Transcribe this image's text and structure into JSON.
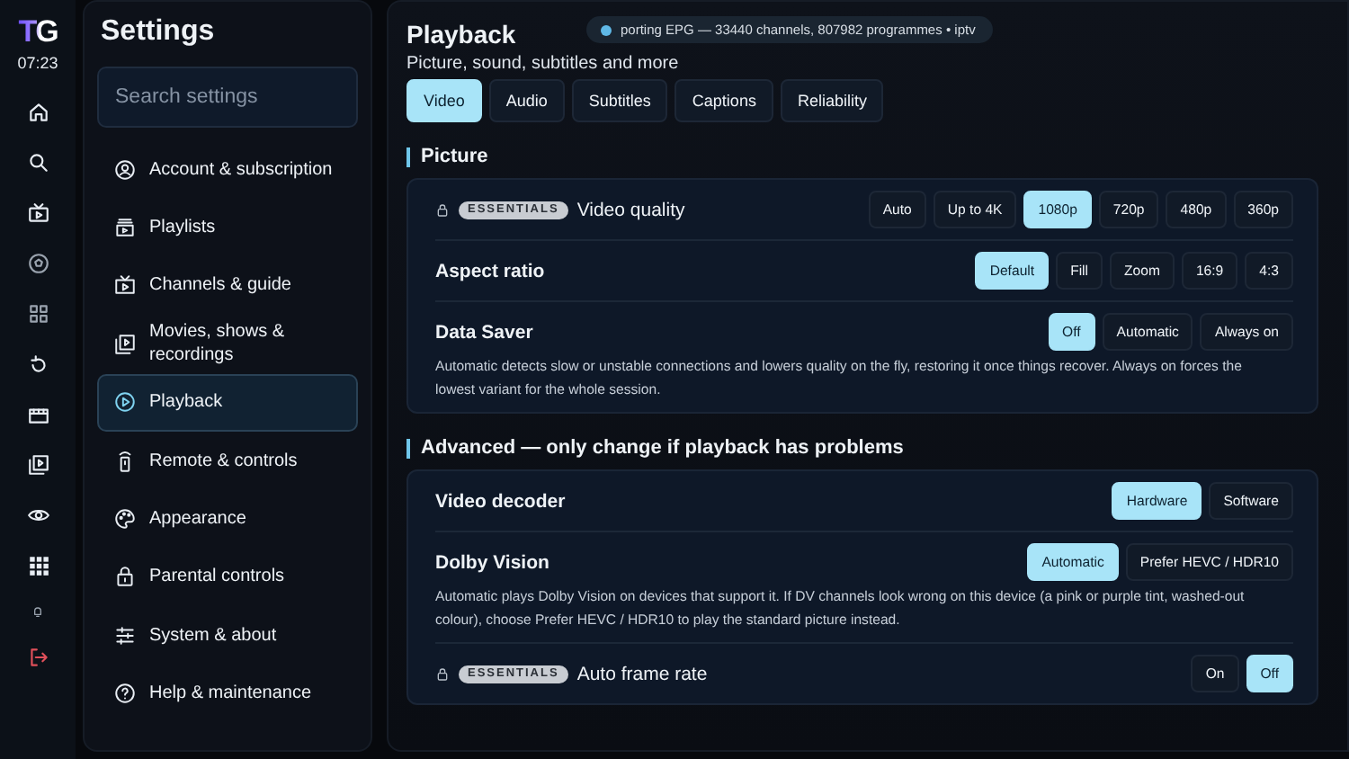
{
  "rail": {
    "logo": "TG",
    "clock": "07:23"
  },
  "sidebar": {
    "title": "Settings",
    "search": {
      "placeholder": "Search settings"
    },
    "items": [
      {
        "label": "Account & subscription",
        "selected": false
      },
      {
        "label": "Playlists",
        "selected": false
      },
      {
        "label": "Channels & guide",
        "selected": false
      },
      {
        "label": "Movies, shows & recordings",
        "selected": false
      },
      {
        "label": "Playback",
        "selected": true
      },
      {
        "label": "Remote & controls",
        "selected": false
      },
      {
        "label": "Appearance",
        "selected": false
      },
      {
        "label": "Parental controls",
        "selected": false
      },
      {
        "label": "System & about",
        "selected": false
      },
      {
        "label": "Help & maintenance",
        "selected": false
      }
    ]
  },
  "main": {
    "title": "Playback",
    "subtitle": "Picture, sound, subtitles and more",
    "toast": "porting EPG — 33440 channels, 807982 programmes • iptv",
    "tabs": [
      {
        "label": "Video",
        "selected": true
      },
      {
        "label": "Audio",
        "selected": false
      },
      {
        "label": "Subtitles",
        "selected": false
      },
      {
        "label": "Captions",
        "selected": false
      },
      {
        "label": "Reliability",
        "selected": false
      }
    ],
    "sections": [
      {
        "title": "Picture",
        "rows": [
          {
            "label": "Video quality",
            "badge": "ESSENTIALS",
            "locked": true,
            "options": [
              {
                "label": "Auto",
                "selected": false
              },
              {
                "label": "Up to 4K",
                "selected": false
              },
              {
                "label": "1080p",
                "selected": true
              },
              {
                "label": "720p",
                "selected": false
              },
              {
                "label": "480p",
                "selected": false
              },
              {
                "label": "360p",
                "selected": false
              }
            ]
          },
          {
            "label": "Aspect ratio",
            "locked": false,
            "options": [
              {
                "label": "Default",
                "selected": true
              },
              {
                "label": "Fill",
                "selected": false
              },
              {
                "label": "Zoom",
                "selected": false
              },
              {
                "label": "16:9",
                "selected": false
              },
              {
                "label": "4:3",
                "selected": false
              }
            ]
          },
          {
            "label": "Data Saver",
            "locked": false,
            "options": [
              {
                "label": "Off",
                "selected": true
              },
              {
                "label": "Automatic",
                "selected": false
              },
              {
                "label": "Always on",
                "selected": false
              }
            ],
            "note": "Automatic detects slow or unstable connections and lowers quality on the fly, restoring it once things recover. Always on forces the lowest variant for the whole session."
          }
        ]
      },
      {
        "title": "Advanced — only change if playback has problems",
        "rows": [
          {
            "label": "Video decoder",
            "locked": false,
            "options": [
              {
                "label": "Hardware",
                "selected": true
              },
              {
                "label": "Software",
                "selected": false
              }
            ]
          },
          {
            "label": "Dolby Vision",
            "locked": false,
            "options": [
              {
                "label": "Automatic",
                "selected": true
              },
              {
                "label": "Prefer HEVC / HDR10",
                "selected": false
              }
            ],
            "note": "Automatic plays Dolby Vision on devices that support it. If DV channels look wrong on this device (a pink or purple tint, washed-out colour), choose Prefer HEVC / HDR10 to play the standard picture instead."
          },
          {
            "label": "Auto frame rate",
            "badge": "ESSENTIALS",
            "locked": true,
            "options": [
              {
                "label": "On",
                "selected": false
              },
              {
                "label": "Off",
                "selected": true
              }
            ]
          }
        ]
      }
    ]
  }
}
